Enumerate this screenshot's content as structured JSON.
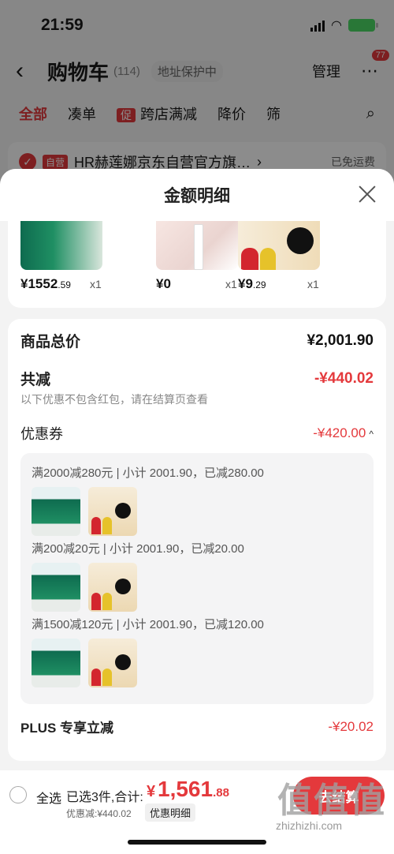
{
  "status_bar": {
    "time": "21:59"
  },
  "cart_header": {
    "title": "购物车",
    "count": "(114)",
    "address_protect": "地址保护中",
    "manage": "管理",
    "more_badge": "77"
  },
  "tabs": {
    "all": "全部",
    "bundle": "凑单",
    "promo_tag": "促",
    "cross_store": "跨店满减",
    "price_drop": "降价",
    "filter": "筛"
  },
  "store": {
    "self_tag": "自营",
    "name": "HR赫莲娜京东自营官方旗…",
    "free_shipping": "已免运费"
  },
  "sheet": {
    "title": "金额明细",
    "products": [
      {
        "price_int": "¥1552",
        "price_dec": ".59",
        "qty": "x1"
      },
      {
        "price_int": "¥0",
        "price_dec": "",
        "qty": "x1"
      },
      {
        "price_int": "¥9",
        "price_dec": ".29",
        "qty": "x1"
      }
    ],
    "subtotal_label": "商品总价",
    "subtotal_value": "¥2,001.90",
    "reduction_label": "共减",
    "reduction_value": "-¥440.02",
    "reduction_note": "以下优惠不包含红包，请在结算页查看",
    "coupon_label": "优惠券",
    "coupon_value": "-¥420.00",
    "coupons": [
      {
        "text": "满2000减280元 | 小计 2001.90，已减280.00"
      },
      {
        "text": "满200减20元 | 小计 2001.90，已减20.00"
      },
      {
        "text": "满1500减120元 | 小计 2001.90，已减120.00"
      }
    ],
    "plus_label": "PLUS 专享立减",
    "plus_value": "-¥20.02"
  },
  "bottom_bar": {
    "select_all": "全选",
    "selected_info": "已选3件,合计:",
    "currency": "¥",
    "total_int": "1,561",
    "total_dec": ".88",
    "discount_note": "优惠减:¥440.02",
    "detail_button": "优惠明细",
    "checkout": "去结算",
    "watermark": "值值值",
    "watermark_url": "zhizhizhi.com"
  }
}
